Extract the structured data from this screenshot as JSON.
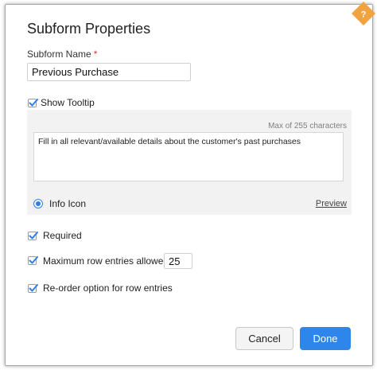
{
  "dialog": {
    "title": "Subform Properties",
    "help_icon": "question-mark-icon",
    "accent_color": "#f2a341"
  },
  "subform_name": {
    "label": "Subform Name",
    "required_marker": "*",
    "value": "Previous Purchase"
  },
  "show_tooltip": {
    "label": "Show Tooltip",
    "checked": true,
    "max_chars_label": "Max of 255 characters",
    "text": "Fill in all relevant/available details about the customer's past purchases",
    "display_option": "Info Icon",
    "preview_label": "Preview"
  },
  "options": {
    "required": {
      "label": "Required",
      "checked": true
    },
    "max_rows": {
      "label": "Maximum row entries allowed",
      "checked": true,
      "value": "25"
    },
    "reorder": {
      "label": "Re-order option for row entries",
      "checked": true
    }
  },
  "buttons": {
    "cancel": "Cancel",
    "done": "Done",
    "primary_color": "#2f86ea"
  }
}
